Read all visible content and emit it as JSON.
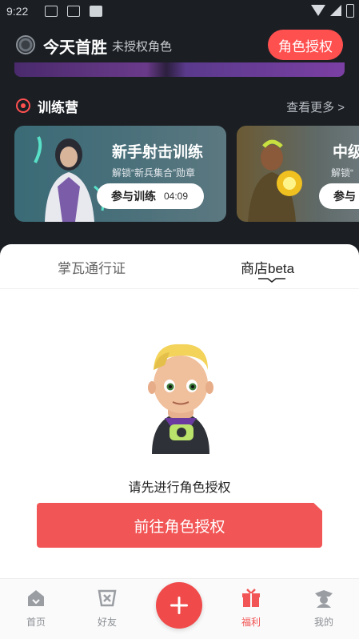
{
  "status_bar": {
    "time": "9:22"
  },
  "header": {
    "title": "今天首胜",
    "subtitle": "未授权角色",
    "auth_button": "角色授权"
  },
  "training": {
    "title": "训练营",
    "see_more": "查看更多 >",
    "cards": [
      {
        "title": "新手射击训练",
        "subtitle": "解锁“新兵集合”勋章",
        "button": "参与训练",
        "timer": "04:09"
      },
      {
        "title": "中级",
        "subtitle": "解锁“",
        "button": "参与"
      }
    ]
  },
  "sheet": {
    "tabs": [
      {
        "label": "掌瓦通行证"
      },
      {
        "label": "商店beta"
      }
    ],
    "active_tab": "商店beta",
    "empty_text": "请先进行角色授权",
    "go_button": "前往角色授权"
  },
  "bottom_nav": {
    "items": [
      {
        "label": "首页",
        "icon": "home-icon"
      },
      {
        "label": "好友",
        "icon": "friends-icon"
      },
      {
        "label": "福利",
        "icon": "gift-icon",
        "active": true
      },
      {
        "label": "我的",
        "icon": "profile-icon"
      }
    ],
    "center_icon": "plus-icon"
  },
  "colors": {
    "accent": "#f25555",
    "dark_bg": "#1b1f24"
  }
}
